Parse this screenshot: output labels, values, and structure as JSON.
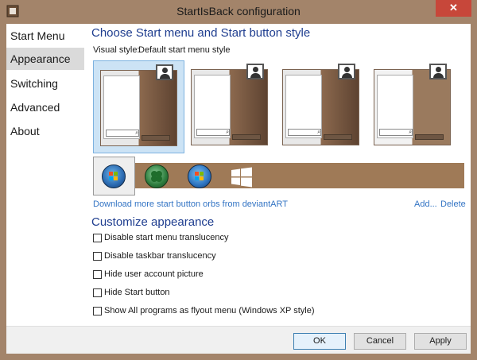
{
  "window": {
    "title": "StartIsBack configuration",
    "close_glyph": "✕"
  },
  "sidebar": {
    "items": [
      {
        "label": "Start Menu",
        "selected": false
      },
      {
        "label": "Appearance",
        "selected": true
      },
      {
        "label": "Switching",
        "selected": false
      },
      {
        "label": "Advanced",
        "selected": false
      },
      {
        "label": "About",
        "selected": false
      }
    ]
  },
  "main": {
    "section1_title": "Choose Start menu and Start button style",
    "visual_style_label": "Visual style:",
    "visual_style_value": "Default start menu style",
    "orb_link": "Download more start button orbs from deviantART",
    "add_link": "Add...",
    "delete_link": "Delete",
    "section2_title": "Customize appearance",
    "options": [
      {
        "label": "Disable start menu translucency",
        "checked": false
      },
      {
        "label": "Disable taskbar translucency",
        "checked": false
      },
      {
        "label": "Hide user account picture",
        "checked": false
      },
      {
        "label": "Hide Start button",
        "checked": false
      },
      {
        "label": "Show All programs as flyout menu (Windows XP style)",
        "checked": false
      }
    ]
  },
  "footer": {
    "ok_label": "OK",
    "cancel_label": "Cancel",
    "apply_label": "Apply"
  },
  "colors": {
    "accent": "#1e3d8f",
    "link": "#3374c4",
    "frame": "#a3846a",
    "close": "#c7473a"
  }
}
